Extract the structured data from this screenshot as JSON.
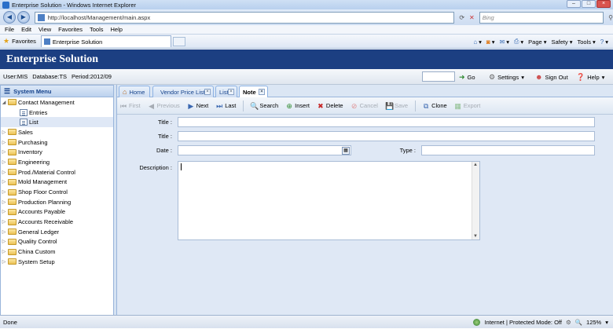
{
  "browser": {
    "window_title": "Enterprise Solution - Windows Internet Explorer",
    "address": "http://localhost/Management/main.aspx",
    "search_placeholder": "Bing",
    "menu": [
      "File",
      "Edit",
      "View",
      "Favorites",
      "Tools",
      "Help"
    ],
    "favorites_label": "Favorites",
    "tab_title": "Enterprise Solution",
    "commands": [
      "Page",
      "Safety",
      "Tools"
    ]
  },
  "app": {
    "title": "Enterprise Solution",
    "user": "User:MIS",
    "database": "Database:TS",
    "period": "Period:2012/09",
    "go_label": "Go",
    "settings_label": "Settings",
    "signout_label": "Sign Out",
    "help_label": "Help"
  },
  "sidebar": {
    "title": "System Menu",
    "items": [
      {
        "label": "Contact Management",
        "type": "folder",
        "expanded": true,
        "level": 0
      },
      {
        "label": "Entries",
        "type": "doc",
        "level": 1
      },
      {
        "label": "List",
        "type": "doc",
        "level": 1,
        "selected": true
      },
      {
        "label": "Sales",
        "type": "folder",
        "level": 0
      },
      {
        "label": "Purchasing",
        "type": "folder",
        "level": 0
      },
      {
        "label": "Inventory",
        "type": "folder",
        "level": 0
      },
      {
        "label": "Engineering",
        "type": "folder",
        "level": 0
      },
      {
        "label": "Prod./Material Control",
        "type": "folder",
        "level": 0
      },
      {
        "label": "Mold Management",
        "type": "folder",
        "level": 0
      },
      {
        "label": "Shop Floor Control",
        "type": "folder",
        "level": 0
      },
      {
        "label": "Production Planning",
        "type": "folder",
        "level": 0
      },
      {
        "label": "Accounts Payable",
        "type": "folder",
        "level": 0
      },
      {
        "label": "Accounts Receivable",
        "type": "folder",
        "level": 0
      },
      {
        "label": "General Ledger",
        "type": "folder",
        "level": 0
      },
      {
        "label": "Quality Control",
        "type": "folder",
        "level": 0
      },
      {
        "label": "China Custom",
        "type": "folder",
        "level": 0
      },
      {
        "label": "System Setup",
        "type": "folder",
        "level": 0
      }
    ]
  },
  "tabs": [
    {
      "label": "Home",
      "closable": false,
      "active": false
    },
    {
      "label": "Vendor Price List",
      "closable": true,
      "active": false
    },
    {
      "label": "List",
      "closable": true,
      "active": false
    },
    {
      "label": "Note",
      "closable": true,
      "active": true
    }
  ],
  "toolbar": {
    "first": "First",
    "previous": "Previous",
    "next": "Next",
    "last": "Last",
    "search": "Search",
    "insert": "Insert",
    "delete": "Delete",
    "cancel": "Cancel",
    "save": "Save",
    "clone": "Clone",
    "export": "Export"
  },
  "form": {
    "title1_label": "Title :",
    "title2_label": "Title :",
    "date_label": "Date :",
    "type_label": "Type :",
    "description_label": "Description :"
  },
  "statusbar": {
    "left": "Done",
    "zone": "Internet | Protected Mode: Off",
    "zoom": "125%"
  }
}
